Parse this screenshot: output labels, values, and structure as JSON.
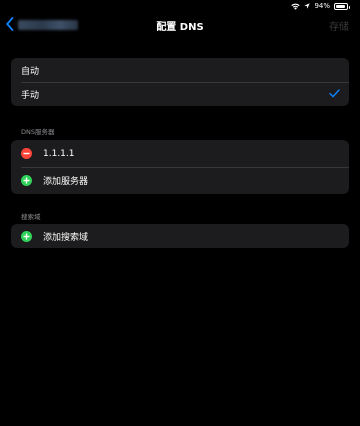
{
  "status": {
    "battery_text": "94%",
    "battery_level": 0.94
  },
  "nav": {
    "back_label": "",
    "title": "配置 DNS",
    "save_label": "存储"
  },
  "mode": {
    "options": [
      {
        "label": "自动",
        "selected": false
      },
      {
        "label": "手动",
        "selected": true
      }
    ]
  },
  "dns": {
    "header": "DNS服务器",
    "servers": [
      "1.1.1.1"
    ],
    "add_label": "添加服务器"
  },
  "search": {
    "header": "搜索域",
    "add_label": "添加搜索域"
  },
  "colors": {
    "accent": "#0a84ff",
    "delete": "#ff453a",
    "add": "#30d158",
    "cell_bg": "#1c1c1e",
    "disabled": "#3a3a3c"
  }
}
